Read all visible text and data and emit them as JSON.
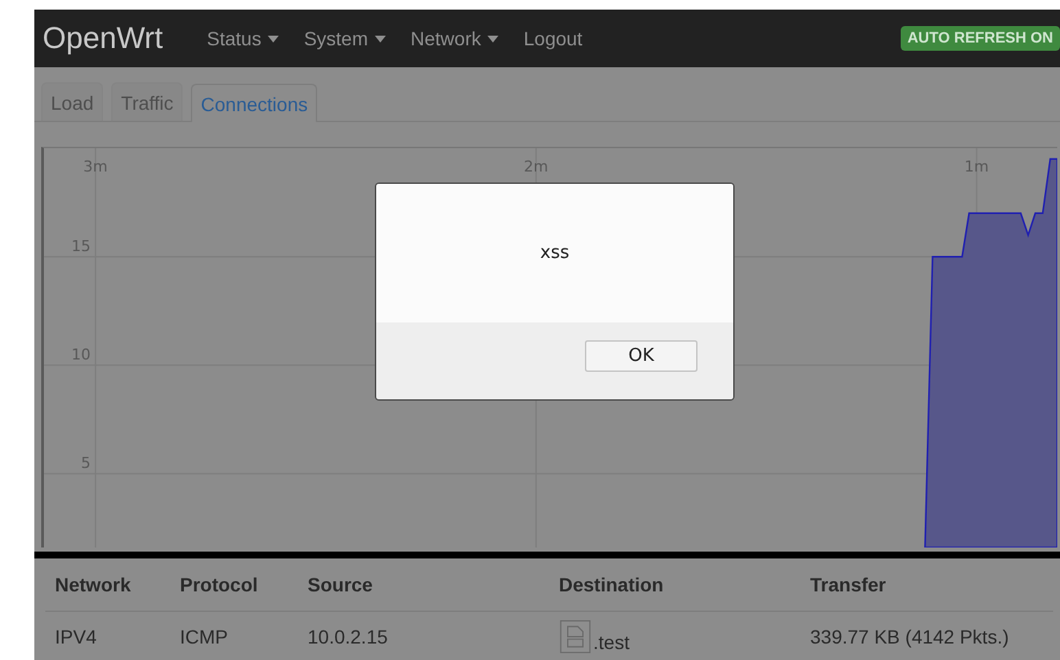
{
  "brand": "OpenWrt",
  "menu": [
    {
      "label": "Status",
      "dropdown": true
    },
    {
      "label": "System",
      "dropdown": true
    },
    {
      "label": "Network",
      "dropdown": true
    },
    {
      "label": "Logout",
      "dropdown": false
    }
  ],
  "badge": "AUTO REFRESH ON",
  "tabs": [
    {
      "label": "Load",
      "selected": false
    },
    {
      "label": "Traffic",
      "selected": false
    },
    {
      "label": "Connections",
      "selected": true
    }
  ],
  "graph": {
    "chart_data": {
      "type": "area",
      "x": [
        1.117,
        1.1,
        1.033,
        1.017,
        0.9,
        0.883,
        0.867,
        0.85,
        0.833,
        0.817
      ],
      "series": [
        {
          "color": "#2020b0",
          "values": [
            1.6,
            15,
            15,
            17,
            17,
            16,
            17,
            17,
            19.5,
            19.5
          ]
        }
      ],
      "xlim": [
        3.117,
        0.817
      ],
      "ylim": [
        1.6,
        20
      ],
      "xticks": [
        {
          "value": 3,
          "label": "3m"
        },
        {
          "value": 2,
          "label": "2m"
        },
        {
          "value": 1,
          "label": "1m"
        }
      ],
      "yticks": [
        5,
        10,
        15
      ],
      "grid": true
    }
  },
  "table": {
    "columns": [
      "Network",
      "Protocol",
      "Source",
      "Destination",
      "Transfer"
    ],
    "rows": [
      {
        "cells": [
          {
            "text": "IPV4"
          },
          {
            "text": "ICMP"
          },
          {
            "text": "10.0.2.15"
          },
          {
            "text": ".test",
            "kind": "image-host"
          },
          {
            "text": "339.77 KB (4142 Pkts.)"
          }
        ]
      }
    ]
  },
  "dialog": {
    "message": "xss",
    "buttons": [
      "OK"
    ]
  }
}
